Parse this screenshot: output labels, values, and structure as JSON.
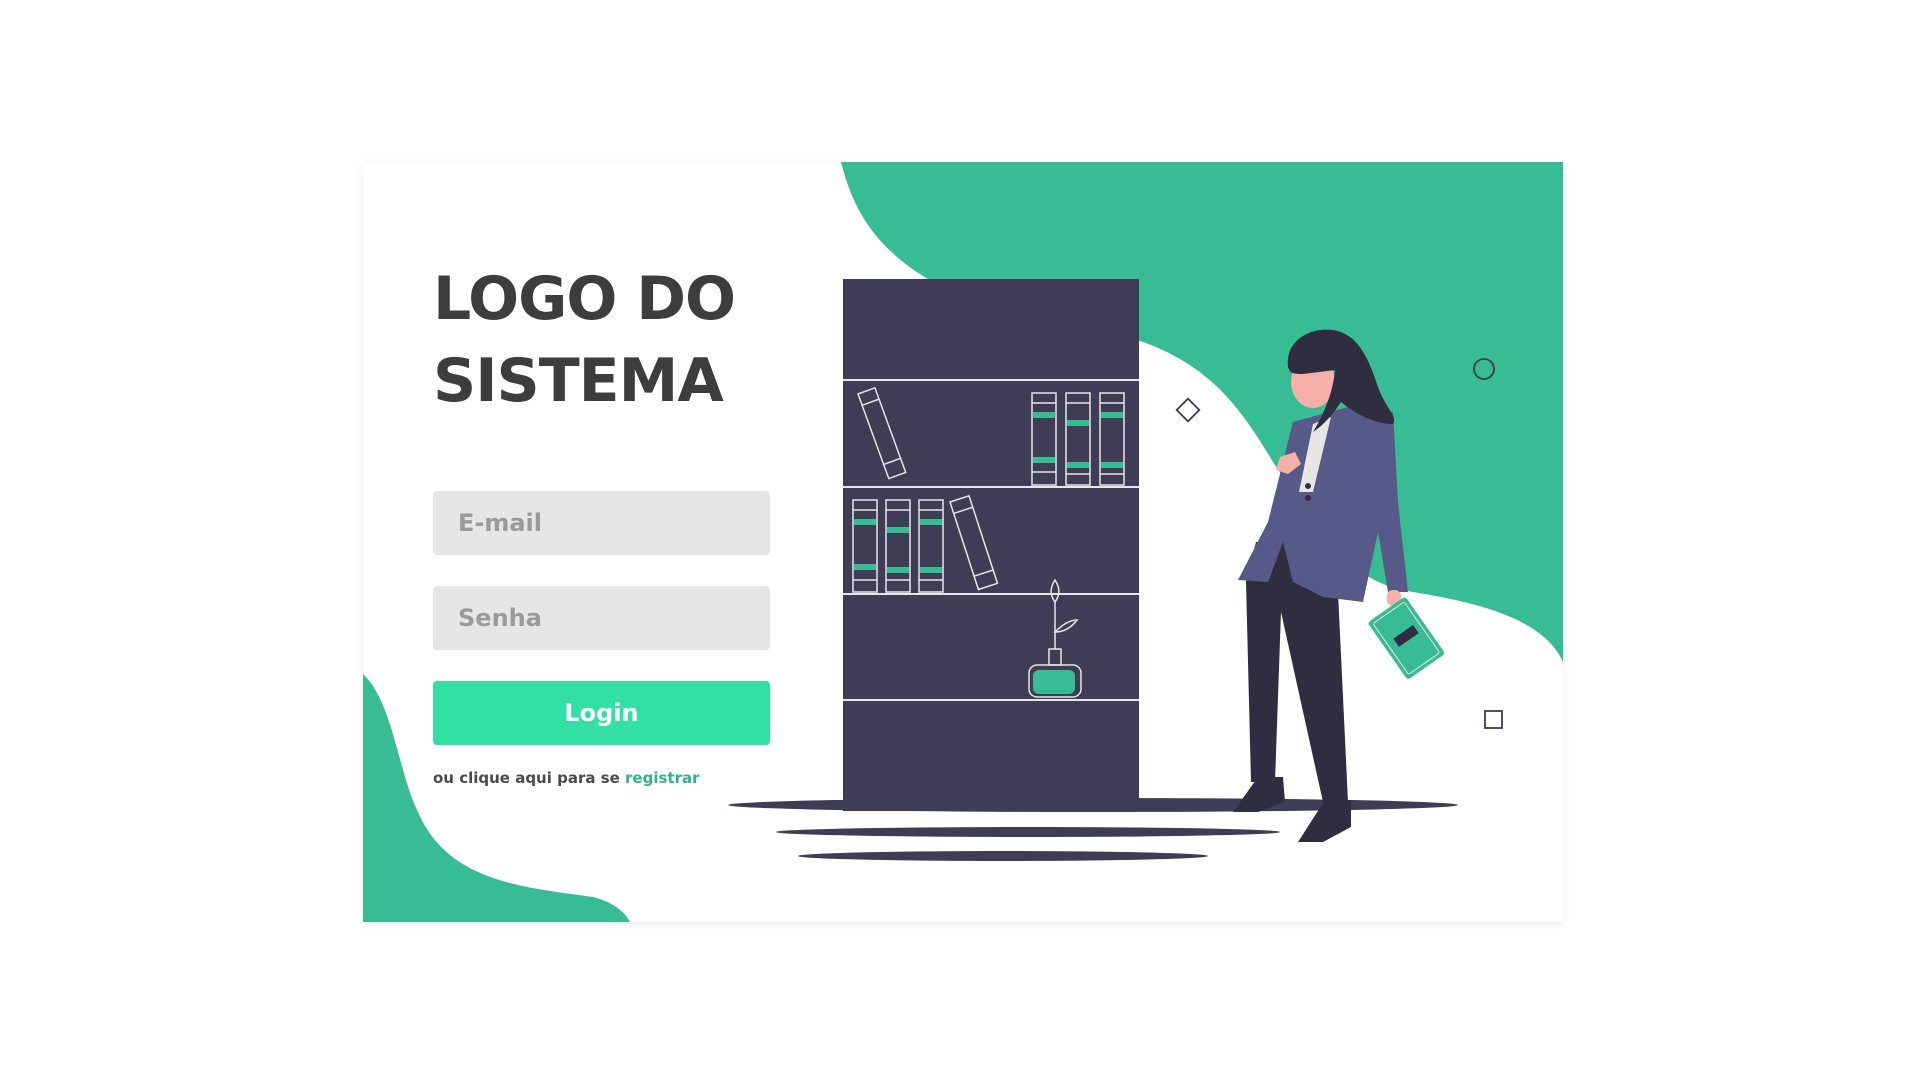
{
  "login": {
    "logo_title": "LOGO DO SISTEMA",
    "email_placeholder": "E-mail",
    "password_placeholder": "Senha",
    "login_button_label": "Login",
    "register_prompt": "ou clique aqui para se",
    "register_link_label": "registrar"
  },
  "colors": {
    "accent": "#38bc93",
    "button": "#33e0a4",
    "link": "#2fb48a",
    "dark": "#3f3d56",
    "text": "#3d3d3d",
    "input_bg": "#e6e6e6"
  },
  "icons": {
    "illustration": "woman-with-bookshelf-illustration"
  }
}
